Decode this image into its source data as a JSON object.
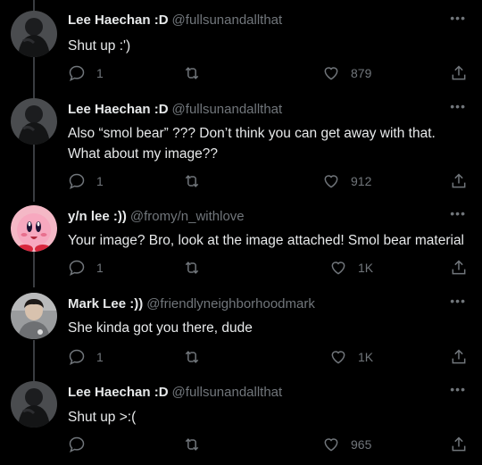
{
  "tweets": [
    {
      "name": "Lee Haechan :D",
      "handle": "@fullsunandallthat",
      "text": "Shut up :')",
      "replies": "1",
      "retweets": "",
      "likes": "879",
      "avatar": "dark-hood"
    },
    {
      "name": "Lee Haechan :D",
      "handle": "@fullsunandallthat",
      "text": "Also “smol bear” ??? Don’t think you can get away with that. What about my image??",
      "replies": "1",
      "retweets": "",
      "likes": "912",
      "avatar": "dark-hood"
    },
    {
      "name": "y/n lee :))",
      "handle": "@fromy/n_withlove",
      "text": "Your image? Bro, look at the image attached! Smol bear material",
      "replies": "1",
      "retweets": "",
      "likes": "1K",
      "avatar": "kirby"
    },
    {
      "name": "Mark Lee :))",
      "handle": "@friendlyneighborhoodmark",
      "text": "She kinda got you there, dude",
      "replies": "1",
      "retweets": "",
      "likes": "1K",
      "avatar": "person-gray"
    },
    {
      "name": "Lee Haechan :D",
      "handle": "@fullsunandallthat",
      "text": "Shut up >:(",
      "replies": "",
      "retweets": "",
      "likes": "965",
      "avatar": "dark-hood"
    }
  ],
  "icons": {
    "more": "more-dots-icon",
    "reply": "reply-icon",
    "retweet": "retweet-icon",
    "like": "heart-icon",
    "share": "share-icon"
  },
  "colors": {
    "background": "#000000",
    "text": "#e7e9ea",
    "muted": "#71767b",
    "thread_line": "#3a3d41"
  }
}
